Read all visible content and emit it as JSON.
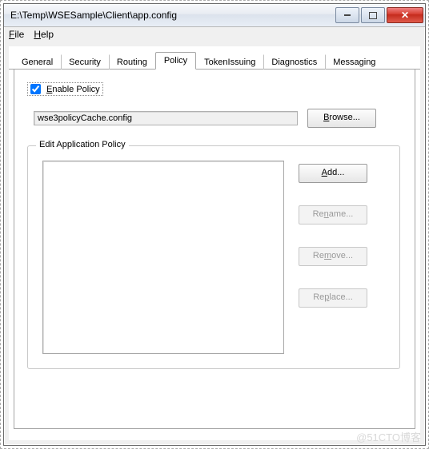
{
  "window": {
    "title": "E:\\Temp\\WSESample\\Client\\app.config"
  },
  "menu": {
    "file": "File",
    "help": "Help"
  },
  "tabs": {
    "general": "General",
    "security": "Security",
    "routing": "Routing",
    "policy": "Policy",
    "tokenIssuing": "TokenIssuing",
    "diagnostics": "Diagnostics",
    "messaging": "Messaging"
  },
  "policy": {
    "enable_label": "Enable Policy",
    "enabled": true,
    "cache_path": "wse3policyCache.config",
    "browse": "Browse...",
    "fieldset_label": "Edit Application Policy",
    "add": "Add...",
    "rename": "Rename...",
    "remove": "Remove...",
    "replace": "Replace..."
  },
  "watermark": "@51CTO博客"
}
